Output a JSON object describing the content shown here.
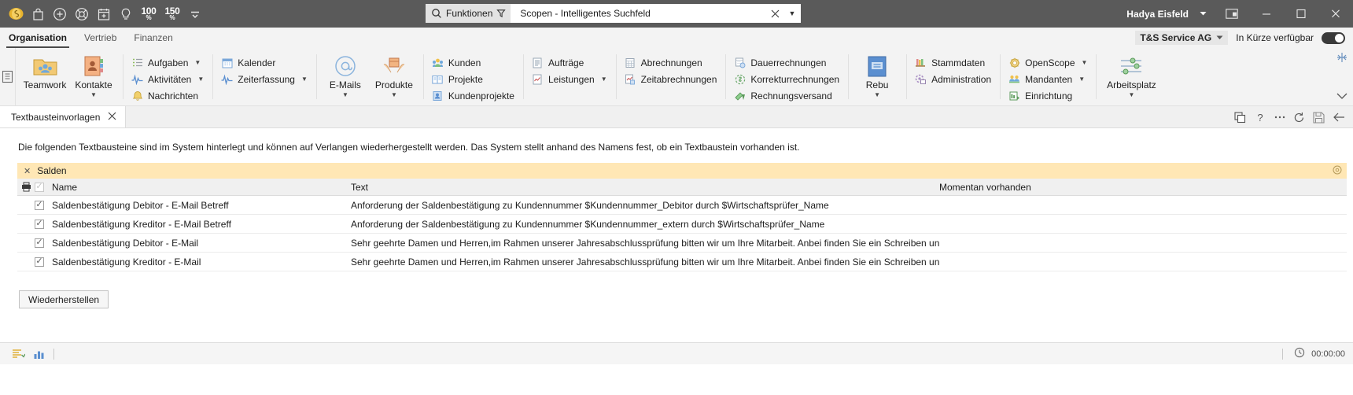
{
  "titlebar": {
    "quick_access": [
      {
        "name": "scopen-logo-icon",
        "label": "Scopen"
      },
      {
        "name": "bag-icon",
        "label": "Tasche"
      },
      {
        "name": "plus-circle-icon",
        "label": "Neu"
      },
      {
        "name": "lifebuoy-icon",
        "label": "Support"
      },
      {
        "name": "calendar-add-icon",
        "label": "Kalender hinzufügen"
      },
      {
        "name": "lightbulb-icon",
        "label": "Idee"
      }
    ],
    "zoom_100": "100",
    "zoom_150": "150",
    "percent": "%",
    "overflow_caret": "▼",
    "search": {
      "scope_label": "Funktionen",
      "filter_icon": "filter-icon",
      "value": "Scopen - Intelligentes Suchfeld",
      "placeholder": "Scopen - Intelligentes Suchfeld",
      "clear_label": "✕",
      "dropdown_caret": "▼"
    },
    "user": "Hadya Eisfeld",
    "user_caret": "▼",
    "window_buttons": {
      "restore_session": "⊞",
      "minimize": "—",
      "maximize": "▢",
      "close": "✕"
    }
  },
  "ribbon_tabs": {
    "items": [
      {
        "label": "Organisation",
        "active": true
      },
      {
        "label": "Vertrieb",
        "active": false
      },
      {
        "label": "Finanzen",
        "active": false
      }
    ],
    "tenant": "T&S Service AG",
    "tenant_caret": "▼",
    "availability_label": "In Kürze verfügbar",
    "availability_on": true
  },
  "ribbon": {
    "groups": [
      {
        "big": [
          {
            "label": "Teamwork",
            "icon": "teamwork-folder-icon",
            "caret": ""
          },
          {
            "label": "Kontakte",
            "icon": "contacts-book-icon",
            "caret": "▼"
          }
        ],
        "small": []
      },
      {
        "big": [],
        "small": [
          {
            "label": "Aufgaben",
            "icon": "tasks-icon",
            "caret": "▼"
          },
          {
            "label": "Aktivitäten",
            "icon": "activities-icon",
            "caret": "▼"
          },
          {
            "label": "Nachrichten",
            "icon": "notifications-bell-icon",
            "caret": ""
          }
        ]
      },
      {
        "big": [],
        "small": [
          {
            "label": "Kalender",
            "icon": "calendar-icon",
            "caret": ""
          },
          {
            "label": "Zeiterfassung",
            "icon": "time-tracking-icon",
            "caret": "▼"
          }
        ]
      },
      {
        "big": [
          {
            "label": "E-Mails",
            "icon": "at-sign-icon",
            "caret": "▼"
          },
          {
            "label": "Produkte",
            "icon": "products-box-icon",
            "caret": "▼"
          }
        ],
        "small": []
      },
      {
        "big": [],
        "small": [
          {
            "label": "Kunden",
            "icon": "customers-icon",
            "caret": ""
          },
          {
            "label": "Projekte",
            "icon": "projects-icon",
            "caret": ""
          },
          {
            "label": "Kundenprojekte",
            "icon": "customer-projects-icon",
            "caret": ""
          }
        ]
      },
      {
        "big": [],
        "small": [
          {
            "label": "Aufträge",
            "icon": "orders-icon",
            "caret": ""
          },
          {
            "label": "Leistungen",
            "icon": "services-icon",
            "caret": "▼"
          }
        ]
      },
      {
        "big": [],
        "small": [
          {
            "label": "Abrechnungen",
            "icon": "billing-icon",
            "caret": ""
          },
          {
            "label": "Zeitabrechnungen",
            "icon": "time-billing-icon",
            "caret": ""
          }
        ]
      },
      {
        "big": [],
        "small": [
          {
            "label": "Dauerrechnungen",
            "icon": "recurring-invoice-icon",
            "caret": ""
          },
          {
            "label": "Korrekturrechnungen",
            "icon": "correction-invoice-icon",
            "caret": ""
          },
          {
            "label": "Rechnungsversand",
            "icon": "invoice-dispatch-icon",
            "caret": ""
          }
        ]
      },
      {
        "big": [
          {
            "label": "Rebu",
            "icon": "rebu-book-icon",
            "caret": "▼"
          }
        ],
        "small": []
      },
      {
        "big": [],
        "small": [
          {
            "label": "Stammdaten",
            "icon": "master-data-icon",
            "caret": ""
          },
          {
            "label": "Administration",
            "icon": "administration-icon",
            "caret": ""
          }
        ]
      },
      {
        "big": [],
        "small": [
          {
            "label": "OpenScope",
            "icon": "openscope-icon",
            "caret": "▼"
          },
          {
            "label": "Mandanten",
            "icon": "clients-icon",
            "caret": "▼"
          },
          {
            "label": "Einrichtung",
            "icon": "setup-icon",
            "caret": ""
          }
        ]
      },
      {
        "big": [
          {
            "label": "Arbeitsplatz",
            "icon": "workstation-sliders-icon",
            "caret": "▼"
          }
        ],
        "small": []
      }
    ],
    "collapse_caret": "⌄",
    "pin_icon": "pin-icon"
  },
  "doctabs": {
    "tabs": [
      {
        "label": "Textbausteinvorlagen",
        "close": "✕",
        "active": true
      }
    ],
    "actions": [
      {
        "name": "copy-icon",
        "glyph": "copy"
      },
      {
        "name": "help-icon",
        "glyph": "?"
      },
      {
        "name": "more-icon",
        "glyph": "…"
      },
      {
        "name": "refresh-icon",
        "glyph": "refresh"
      },
      {
        "name": "save-icon",
        "glyph": "save"
      },
      {
        "name": "back-arrow-icon",
        "glyph": "←"
      }
    ]
  },
  "main": {
    "description": "Die folgenden Textbausteine sind im System hinterlegt und können auf Verlangen wiederhergestellt werden. Das System stellt anhand des Namens fest, ob ein Textbaustein vorhanden ist.",
    "group_band": {
      "close": "✕",
      "label": "Salden",
      "right_icon": "settings-gear-icon"
    },
    "grid": {
      "printer_icon": "printer-icon",
      "header_checkbox_checked": true,
      "columns": [
        {
          "key": "name",
          "label": "Name"
        },
        {
          "key": "text",
          "label": "Text"
        },
        {
          "key": "avail",
          "label": "Momentan vorhanden"
        }
      ],
      "rows": [
        {
          "checked": true,
          "name": "Saldenbestätigung Debitor - E-Mail Betreff",
          "text": "Anforderung der Saldenbestätigung zu Kundennummer $Kundennummer_Debitor durch $Wirtschaftsprüfer_Name",
          "avail": ""
        },
        {
          "checked": true,
          "name": "Saldenbestätigung Kreditor - E-Mail Betreff",
          "text": "Anforderung der Saldenbestätigung zu Kundennummer $Kundennummer_extern durch $Wirtschaftsprüfer_Name",
          "avail": ""
        },
        {
          "checked": true,
          "name": "Saldenbestätigung Debitor - E-Mail",
          "text": "Sehr geehrte Damen und Herren,im Rahmen unserer Jahresabschlussprüfung bitten wir um Ihre Mitarbeit. Anbei finden Sie ein Schreiben unserer Wirtsc...",
          "avail": ""
        },
        {
          "checked": true,
          "name": "Saldenbestätigung Kreditor - E-Mail",
          "text": "Sehr geehrte Damen und Herren,im Rahmen unserer Jahresabschlussprüfung bitten wir um Ihre Mitarbeit. Anbei finden Sie ein Schreiben unserer Wirtsc...",
          "avail": ""
        }
      ]
    },
    "restore_button": "Wiederherstellen"
  },
  "statusbar": {
    "left_icons": [
      {
        "name": "list-lines-icon"
      },
      {
        "name": "bar-chart-icon"
      }
    ],
    "clock_icon": "clock-icon",
    "timer": "00:00:00"
  },
  "colors": {
    "titlebar": "#5a5a5a",
    "ribbon_bg": "#f3f3f3",
    "group_band": "#ffe7b5",
    "accent": "#e8b44a"
  }
}
